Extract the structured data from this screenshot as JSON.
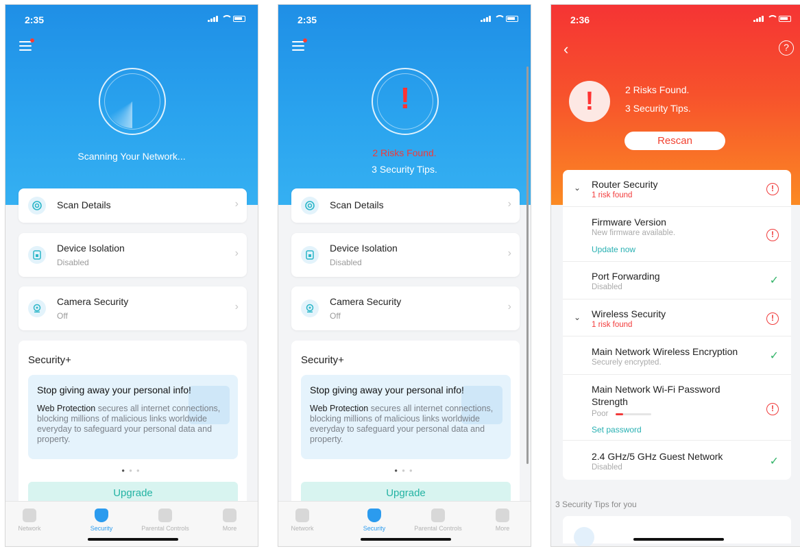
{
  "screens": [
    {
      "status_time": "2:35",
      "hero": {
        "line1": "Scanning Your Network...",
        "line2": ""
      },
      "cards": [
        {
          "title": "Scan Details",
          "sub": ""
        },
        {
          "title": "Device Isolation",
          "sub": "Disabled"
        },
        {
          "title": "Camera Security",
          "sub": "Off"
        }
      ]
    },
    {
      "status_time": "2:35",
      "hero": {
        "line1": "2 Risks Found.",
        "line2": "3 Security Tips."
      },
      "cards": [
        {
          "title": "Scan Details",
          "sub": ""
        },
        {
          "title": "Device Isolation",
          "sub": "Disabled"
        },
        {
          "title": "Camera Security",
          "sub": "Off"
        }
      ]
    },
    {
      "status_time": "2:36",
      "hero": {
        "line1": "2 Risks Found.",
        "line2": "3 Security Tips."
      },
      "rescan_label": "Rescan",
      "rows": [
        {
          "name": "Router Security",
          "sub": "1 risk found",
          "link": "",
          "status": "risk",
          "group": true
        },
        {
          "name": "Firmware Version",
          "sub": "New firmware available.",
          "link": "Update now",
          "status": "risk",
          "group": false
        },
        {
          "name": "Port Forwarding",
          "sub": "Disabled",
          "link": "",
          "status": "ok",
          "group": false
        },
        {
          "name": "Wireless Security",
          "sub": "1 risk found",
          "link": "",
          "status": "risk",
          "group": true
        },
        {
          "name": "Main Network Wireless Encryption",
          "sub": "Securely encrypted.",
          "link": "",
          "status": "ok",
          "group": false
        },
        {
          "name": "Main Network Wi-Fi Password Strength",
          "sub": "Poor",
          "link": "Set password",
          "status": "risk",
          "group": false,
          "strength": 0.22
        },
        {
          "name": "2.4 GHz/5 GHz Guest Network",
          "sub": "Disabled",
          "link": "",
          "status": "ok",
          "group": false
        }
      ],
      "tips_header": "3 Security Tips for you"
    }
  ],
  "security_plus": {
    "heading": "Security+",
    "promo_title": "Stop giving away your personal info!",
    "promo_bold": "Web Protection",
    "promo_body": " secures all internet connections, blocking millions of malicious links worldwide everyday to safeguard your personal data and property.",
    "upgrade_label": "Upgrade",
    "page_index": 1,
    "page_count": 3
  },
  "tabs": [
    {
      "label": "Network",
      "icon": "planet-icon"
    },
    {
      "label": "Security",
      "icon": "shield-icon",
      "active": true
    },
    {
      "label": "Parental Controls",
      "icon": "family-icon"
    },
    {
      "label": "More",
      "icon": "grid-icon"
    }
  ],
  "colors": {
    "accent_blue": "#2b9bee",
    "danger_red": "#f33",
    "teal": "#23b3a3",
    "ok_green": "#35b46a"
  }
}
